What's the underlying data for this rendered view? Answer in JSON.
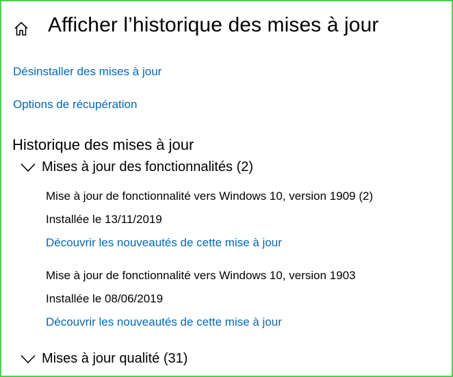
{
  "header": {
    "title": "Afficher l’historique des mises à jour"
  },
  "links": {
    "uninstall": "Désinstaller des mises à jour",
    "recovery": "Options de récupération"
  },
  "history": {
    "heading": "Historique des mises à jour",
    "groups": [
      {
        "label": "Mises à jour des fonctionnalités (2)",
        "expanded": true,
        "items": [
          {
            "title": "Mise à jour de fonctionnalité vers Windows 10, version 1909 (2)",
            "installed": "Installée le 13/11/2019",
            "link": "Découvrir les nouveautés de cette mise à jour"
          },
          {
            "title": "Mise à jour de fonctionnalité vers Windows 10, version 1903",
            "installed": "Installée le 08/06/2019",
            "link": "Découvrir les nouveautés de cette mise à jour"
          }
        ]
      },
      {
        "label": "Mises à jour qualité (31)",
        "expanded": true,
        "items": []
      }
    ]
  },
  "colors": {
    "link": "#0067b8",
    "frame_border": "#4cd04c",
    "text": "#000000"
  },
  "icons": {
    "home": "home-icon",
    "chevron": "chevron-down-icon"
  }
}
